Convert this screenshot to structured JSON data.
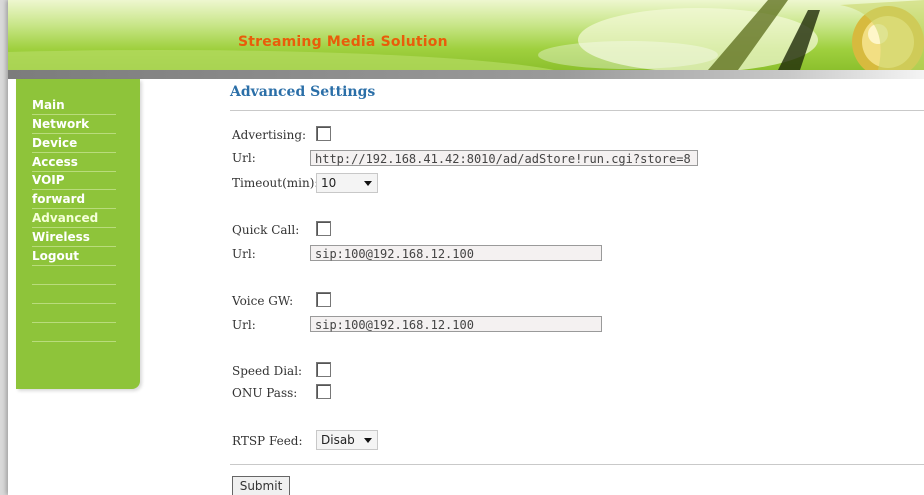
{
  "header": {
    "title": "Streaming Media Solution"
  },
  "sidebar": {
    "items": [
      {
        "label": "Main"
      },
      {
        "label": "Network"
      },
      {
        "label": "Device"
      },
      {
        "label": "Access"
      },
      {
        "label": "VOIP"
      },
      {
        "label": "forward"
      },
      {
        "label": "Advanced",
        "active": true
      },
      {
        "label": "Wireless"
      },
      {
        "label": "Logout"
      }
    ]
  },
  "page": {
    "title": "Advanced Settings"
  },
  "advertising": {
    "label": "Advertising:",
    "checked": false,
    "url_label": "Url:",
    "url_value": "http://192.168.41.42:8010/ad/adStore!run.cgi?store=8",
    "timeout_label": "Timeout(min):",
    "timeout_value": "10"
  },
  "quick_call": {
    "label": "Quick Call:",
    "checked": false,
    "url_label": "Url:",
    "url_value": "sip:100@192.168.12.100"
  },
  "voice_gw": {
    "label": "Voice GW:",
    "checked": false,
    "url_label": "Url:",
    "url_value": "sip:100@192.168.12.100"
  },
  "speed_dial": {
    "label": "Speed Dial:",
    "checked": false
  },
  "onu_pass": {
    "label": "ONU Pass:",
    "checked": false
  },
  "rtsp_feed": {
    "label": "RTSP Feed:",
    "value": "Disab"
  },
  "actions": {
    "submit_label": "Submit"
  },
  "colors": {
    "sidebar": "#8ec43a",
    "title": "#e85d0a",
    "heading": "#2b6fa8"
  },
  "icons": [
    "chevron-down-icon"
  ]
}
